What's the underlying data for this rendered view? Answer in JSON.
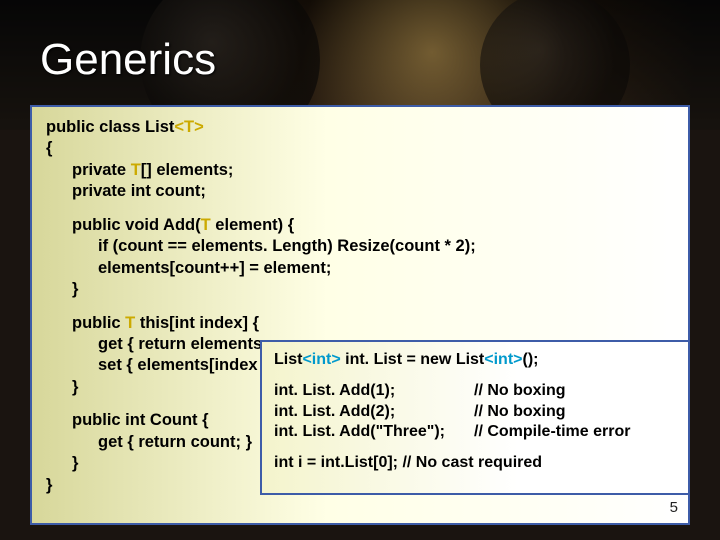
{
  "domain": "Document",
  "title": "Generics",
  "page_number": "5",
  "code": {
    "l1a": "public class List",
    "l1b": "<T>",
    "l2": "{",
    "l3a": "private ",
    "l3b": "T",
    "l3c": "[] elements;",
    "l4": "private int count;",
    "l5a": "public void Add(",
    "l5b": "T",
    "l5c": " element) {",
    "l6": "if (count == elements. Length) Resize(count * 2);",
    "l7": "elements[count++] = element;",
    "l8": "}",
    "l9a": "public ",
    "l9b": "T",
    "l9c": " this[int index] {",
    "l10": "get { return elements",
    "l11": "set { elements[index",
    "l12": "}",
    "l13": "public int Count {",
    "l14": "get { return count; }",
    "l15": "}",
    "l16": "}"
  },
  "popup": {
    "p1a": "List",
    "p1b": "<int>",
    "p1c": " int. List = new List",
    "p1d": "<int>",
    "p1e": "();",
    "r1a": "int. List. Add(1);",
    "r1b": "// No boxing",
    "r2a": "int. List. Add(2);",
    "r2b": "// No boxing",
    "r3a": "int. List. Add(\"Three\");",
    "r3b": "// Compile-time error",
    "p5": "int i = int.List[0];  // No cast required"
  }
}
